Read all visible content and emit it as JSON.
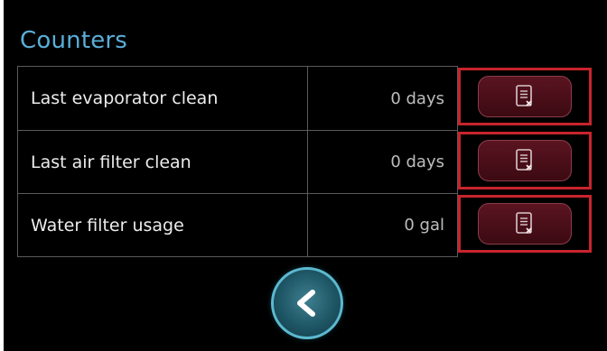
{
  "title": "Counters",
  "counters": [
    {
      "label": "Last evaporator clean",
      "value": "0 days",
      "reset_icon": "reset-counter-icon"
    },
    {
      "label": "Last air filter clean",
      "value": "0 days",
      "reset_icon": "reset-counter-icon"
    },
    {
      "label": "Water filter usage",
      "value": "0 gal",
      "reset_icon": "reset-counter-icon"
    }
  ],
  "back_icon": "chevron-left-icon",
  "colors": {
    "title": "#5aaed8",
    "highlight": "#c8242d",
    "button_fill": "#4a101a",
    "back_button": "#5cb9cf"
  }
}
